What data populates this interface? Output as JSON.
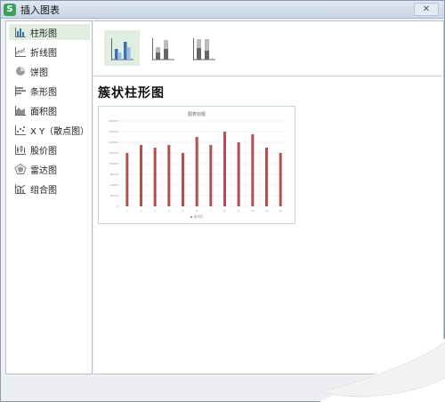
{
  "window": {
    "title": "插入图表",
    "app_icon_glyph": "S",
    "close_glyph": "✕"
  },
  "sidebar": {
    "items": [
      {
        "label": "柱形图",
        "icon": "column-chart-icon",
        "selected": true
      },
      {
        "label": "折线图",
        "icon": "line-chart-icon",
        "selected": false
      },
      {
        "label": "饼图",
        "icon": "pie-chart-icon",
        "selected": false
      },
      {
        "label": "条形图",
        "icon": "bar-chart-icon",
        "selected": false
      },
      {
        "label": "面积图",
        "icon": "area-chart-icon",
        "selected": false
      },
      {
        "label": "X Y（散点图）",
        "icon": "scatter-chart-icon",
        "selected": false
      },
      {
        "label": "股价图",
        "icon": "stock-chart-icon",
        "selected": false
      },
      {
        "label": "雷达图",
        "icon": "radar-chart-icon",
        "selected": false
      },
      {
        "label": "组合图",
        "icon": "combo-chart-icon",
        "selected": false
      }
    ]
  },
  "subtypes": [
    {
      "icon": "clustered-column-icon",
      "selected": true
    },
    {
      "icon": "stacked-column-icon",
      "selected": false
    },
    {
      "icon": "percent-stacked-column-icon",
      "selected": false
    }
  ],
  "main": {
    "chart_type_title": "簇状柱形图"
  },
  "colors": {
    "accent_selected": "#dfeee1",
    "bar_color": "#b5504c",
    "icon_blue": "#3b6fb6"
  },
  "chart_data": {
    "type": "bar",
    "title": "图表标题",
    "categories": [
      "1",
      "2",
      "3",
      "4",
      "5",
      "6",
      "7",
      "8",
      "9",
      "10",
      "11",
      "12"
    ],
    "series": [
      {
        "values": [
          100000,
          115000,
          110000,
          115000,
          100000,
          130000,
          115000,
          140000,
          120000,
          135000,
          110000,
          100000
        ]
      }
    ],
    "ylim": [
      0,
      160000
    ],
    "yticks": [
      0,
      20000,
      40000,
      60000,
      80000,
      100000,
      120000,
      140000,
      160000
    ],
    "grid": true,
    "legend_position": "bottom",
    "legend": [
      "▪ 系列1"
    ]
  }
}
